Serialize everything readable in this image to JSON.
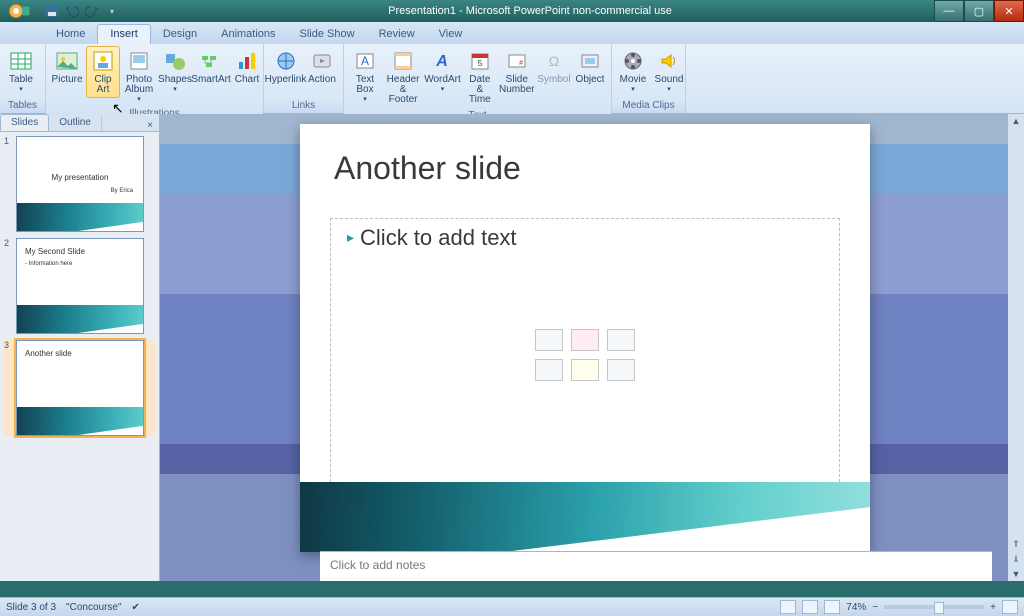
{
  "window": {
    "title": "Presentation1 - Microsoft PowerPoint non-commercial use"
  },
  "tabs": {
    "home": "Home",
    "insert": "Insert",
    "design": "Design",
    "animations": "Animations",
    "slideshow": "Slide Show",
    "review": "Review",
    "view": "View"
  },
  "ribbon": {
    "groups": {
      "tables": "Tables",
      "illustrations": "Illustrations",
      "links": "Links",
      "text": "Text",
      "mediaclips": "Media Clips"
    },
    "btns": {
      "table": "Table",
      "picture": "Picture",
      "clipart": "Clip",
      "clipart2": "Art",
      "photoalbum": "Photo",
      "photoalbum2": "Album",
      "shapes": "Shapes",
      "smartart": "SmartArt",
      "chart": "Chart",
      "hyperlink": "Hyperlink",
      "action": "Action",
      "textbox": "Text",
      "textbox2": "Box",
      "headerfooter": "Header",
      "headerfooter2": "& Footer",
      "wordart": "WordArt",
      "datetime": "Date",
      "datetime2": "& Time",
      "slidenumber": "Slide",
      "slidenumber2": "Number",
      "symbol": "Symbol",
      "object": "Object",
      "movie": "Movie",
      "sound": "Sound"
    }
  },
  "panel": {
    "slides_tab": "Slides",
    "outline_tab": "Outline",
    "thumbs": [
      {
        "n": "1",
        "title": "My presentation",
        "sub": "By Erica"
      },
      {
        "n": "2",
        "title": "My Second Slide",
        "sub": "- Information here"
      },
      {
        "n": "3",
        "title": "Another slide",
        "sub": ""
      }
    ]
  },
  "slide": {
    "title": "Another slide",
    "body_placeholder": "Click to add text"
  },
  "notes": {
    "placeholder": "Click to add notes"
  },
  "status": {
    "slide_info": "Slide 3 of 3",
    "theme": "\"Concourse\"",
    "zoom": "74%"
  }
}
